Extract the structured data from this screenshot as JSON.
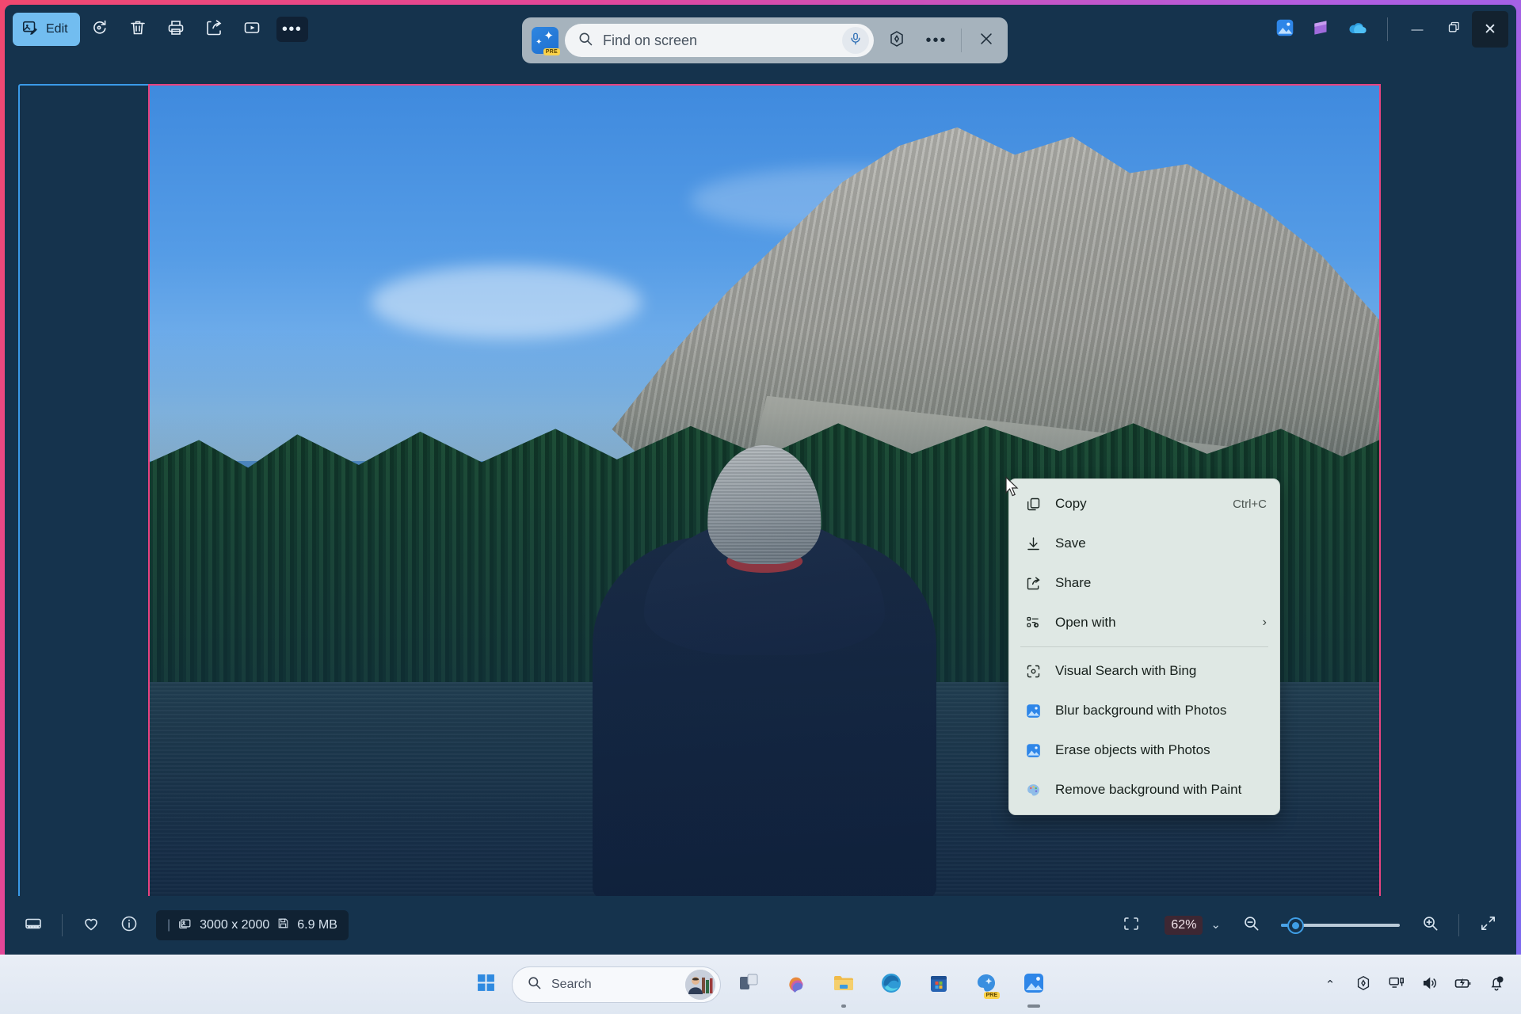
{
  "app": {
    "name": "Photos",
    "accent_gradient_start": "#f0486f",
    "accent_gradient_end": "#7b6bf0",
    "window_bg": "#15334d"
  },
  "toolbar": {
    "edit_label": "Edit",
    "buttons": [
      {
        "name": "rotate-button",
        "icon": "rotate-icon"
      },
      {
        "name": "delete-button",
        "icon": "trash-icon"
      },
      {
        "name": "print-button",
        "icon": "printer-icon"
      },
      {
        "name": "share-button",
        "icon": "share-icon"
      },
      {
        "name": "slideshow-button",
        "icon": "play-box-icon"
      },
      {
        "name": "see-more-button",
        "icon": "ellipsis-icon",
        "label": "•••"
      }
    ]
  },
  "find_bar": {
    "app_icon_badge": "PRE",
    "placeholder": "Find on screen",
    "value": "",
    "mic_icon": "microphone-icon",
    "copilot_icon": "copilot-hex-icon",
    "more_icon": "ellipsis-icon",
    "more_label": "•••",
    "close_icon": "close-icon"
  },
  "window_controls": {
    "photos_icon": "photos-app-icon",
    "clipchamp_icon": "clipchamp-app-icon",
    "onedrive_icon": "onedrive-cloud-icon",
    "minimize": "—",
    "maximize": "restore-icon",
    "close": "✕"
  },
  "photo": {
    "alt": "Person in dark jacket and gray beanie facing a mountain lake",
    "selection_border_color": "#3a9ae8",
    "image_border_color": "#e8427f"
  },
  "context_menu": {
    "items": [
      {
        "label": "Copy",
        "accel": "Ctrl+C",
        "icon": "copy-icon",
        "submenu": false
      },
      {
        "label": "Save",
        "accel": "",
        "icon": "download-save-icon",
        "submenu": false
      },
      {
        "label": "Share",
        "accel": "",
        "icon": "share-arrow-icon",
        "submenu": false
      },
      {
        "label": "Open with",
        "accel": "",
        "icon": "open-with-icon",
        "submenu": true
      },
      {
        "label": "Visual Search with Bing",
        "accel": "",
        "icon": "visual-search-icon",
        "submenu": false
      },
      {
        "label": "Blur background with Photos",
        "accel": "",
        "icon": "photos-app-icon",
        "submenu": false
      },
      {
        "label": "Erase objects with Photos",
        "accel": "",
        "icon": "photos-app-icon",
        "submenu": false
      },
      {
        "label": "Remove background with Paint",
        "accel": "",
        "icon": "paint-app-icon",
        "submenu": false
      }
    ],
    "separator_after_index": 3,
    "submenu_chevron": "›"
  },
  "status_bar": {
    "filmstrip_icon": "filmstrip-icon",
    "favorite_icon": "heart-icon",
    "info_icon": "info-icon",
    "divider": "|",
    "dimensions_icon": "image-size-icon",
    "dimensions": "3000 x 2000",
    "filesize_icon": "save-disk-icon",
    "filesize": "6.9 MB",
    "fit_icon": "fit-to-window-icon",
    "zoom_value": "62%",
    "zoom_chevron": "⌄",
    "zoom_out_icon": "zoom-out-icon",
    "zoom_in_icon": "zoom-in-icon",
    "fullscreen_icon": "fullscreen-icon",
    "slider_percent": 10
  },
  "taskbar": {
    "start_icon": "windows-start-icon",
    "search_placeholder": "Search",
    "search_icon": "search-icon",
    "search_avatar": "person-bookshelf-avatar",
    "apps": [
      {
        "name": "task-view",
        "icon": "task-view-icon",
        "state": "idle"
      },
      {
        "name": "copilot",
        "icon": "copilot-swirl-icon",
        "state": "idle"
      },
      {
        "name": "file-explorer",
        "icon": "folder-icon",
        "state": "running"
      },
      {
        "name": "microsoft-edge",
        "icon": "edge-icon",
        "state": "idle"
      },
      {
        "name": "microsoft-store",
        "icon": "store-icon",
        "state": "idle"
      },
      {
        "name": "paint",
        "icon": "paint-pre-icon",
        "state": "idle"
      },
      {
        "name": "photos",
        "icon": "photos-app-icon",
        "state": "active"
      }
    ],
    "tray": [
      {
        "name": "show-hidden-icons",
        "icon": "chevron-up-icon",
        "glyph": "⌃"
      },
      {
        "name": "copilot-tray",
        "icon": "copilot-hex-icon"
      },
      {
        "name": "network",
        "icon": "network-ethernet-icon"
      },
      {
        "name": "volume",
        "icon": "speaker-icon"
      },
      {
        "name": "battery",
        "icon": "battery-charging-icon"
      },
      {
        "name": "notifications",
        "icon": "bell-do-not-disturb-icon"
      }
    ]
  }
}
